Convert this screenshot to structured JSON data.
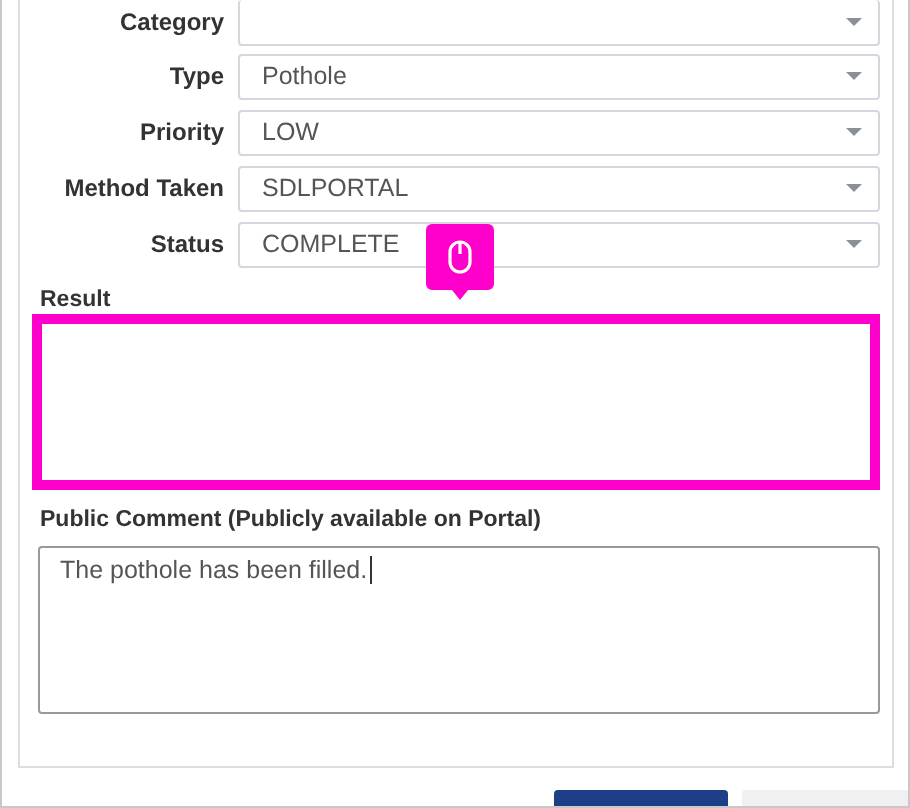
{
  "fields": [
    {
      "label": "Category"
    },
    {
      "label": "Type",
      "value": "Pothole"
    },
    {
      "label": "Priority",
      "value": "LOW"
    },
    {
      "label": "Method Taken",
      "value": "SDLPORTAL"
    },
    {
      "label": "Status",
      "value": "COMPLETE"
    }
  ],
  "result": {
    "label": "Result",
    "highlighted": true
  },
  "public_comment": {
    "label": "Public Comment (Publicly available on Portal)",
    "value": "The pothole has been filled."
  },
  "buttons": [
    {
      "kind": "primary"
    },
    {
      "kind": "secondary"
    }
  ]
}
